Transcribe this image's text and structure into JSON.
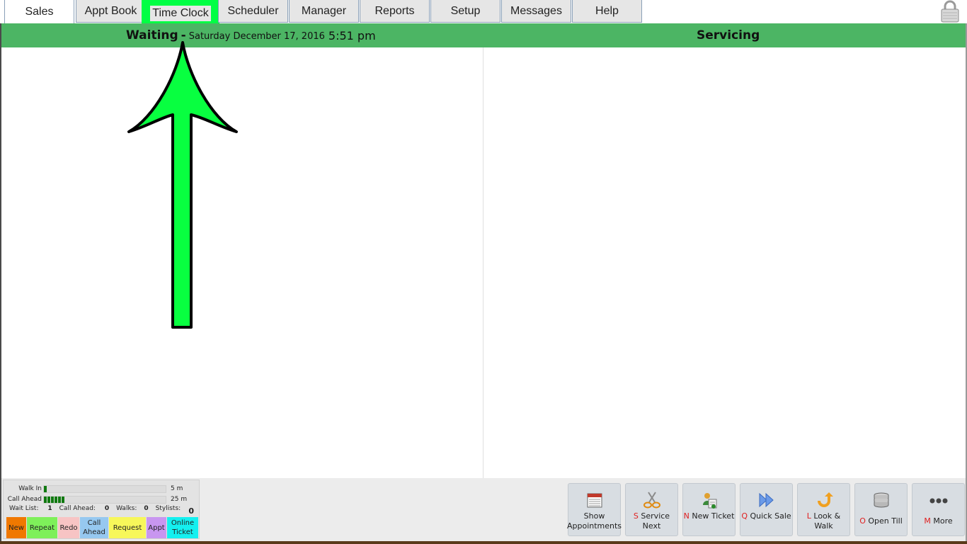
{
  "tabs": [
    {
      "label": "Sales",
      "state": "active"
    },
    {
      "label": "Appt Book",
      "state": "normal"
    },
    {
      "label": "Time Clock",
      "state": "highlight"
    },
    {
      "label": "Scheduler",
      "state": "normal"
    },
    {
      "label": "Manager",
      "state": "normal"
    },
    {
      "label": "Reports",
      "state": "normal"
    },
    {
      "label": "Setup",
      "state": "normal"
    },
    {
      "label": "Messages",
      "state": "normal"
    },
    {
      "label": "Help",
      "state": "normal"
    }
  ],
  "header": {
    "waiting_title": "Waiting",
    "separator": "-",
    "date": "Saturday December 17, 2016",
    "time": "5:51 pm",
    "servicing_title": "Servicing"
  },
  "queue": {
    "walk_in_label": "Walk In",
    "walk_in_value": "5 m",
    "call_ahead_label": "Call Ahead",
    "call_ahead_value": "25 m",
    "wait_list_label": "Wait List:",
    "wait_list_count": "1",
    "call_ahead_count_label": "Call Ahead:",
    "call_ahead_count": "0",
    "walks_label": "Walks:",
    "walks_count": "0",
    "stylists_label": "Stylists:",
    "total": "0"
  },
  "legend": [
    {
      "label": "New",
      "color": "#f07800"
    },
    {
      "label": "Repeat",
      "color": "#7ef05a"
    },
    {
      "label": "Redo",
      "color": "#f7c4c4"
    },
    {
      "label": "Call Ahead",
      "color": "#96c8f0"
    },
    {
      "label": "Request",
      "color": "#f7f75a"
    },
    {
      "label": "Appt",
      "color": "#c896f0"
    },
    {
      "label": "Online Ticket",
      "color": "#14f0f0"
    }
  ],
  "actions": [
    {
      "key": "",
      "label": "Show Appointments",
      "icon": "calendar-icon"
    },
    {
      "key": "S",
      "label": "Service Next",
      "icon": "scissors-icon"
    },
    {
      "key": "N",
      "label": "New Ticket",
      "icon": "new-ticket-icon"
    },
    {
      "key": "Q",
      "label": "Quick Sale",
      "icon": "fast-forward-icon"
    },
    {
      "key": "L",
      "label": "Look & Walk",
      "icon": "u-turn-icon"
    },
    {
      "key": "O",
      "label": "Open Till",
      "icon": "till-stack-icon"
    },
    {
      "key": "M",
      "label": "More",
      "icon": "more-dots-icon"
    }
  ],
  "colors": {
    "header_green": "#4cb564",
    "highlight_green": "#00ff44",
    "arrow_green": "#08ff40",
    "hotkey_red": "#e02020"
  }
}
